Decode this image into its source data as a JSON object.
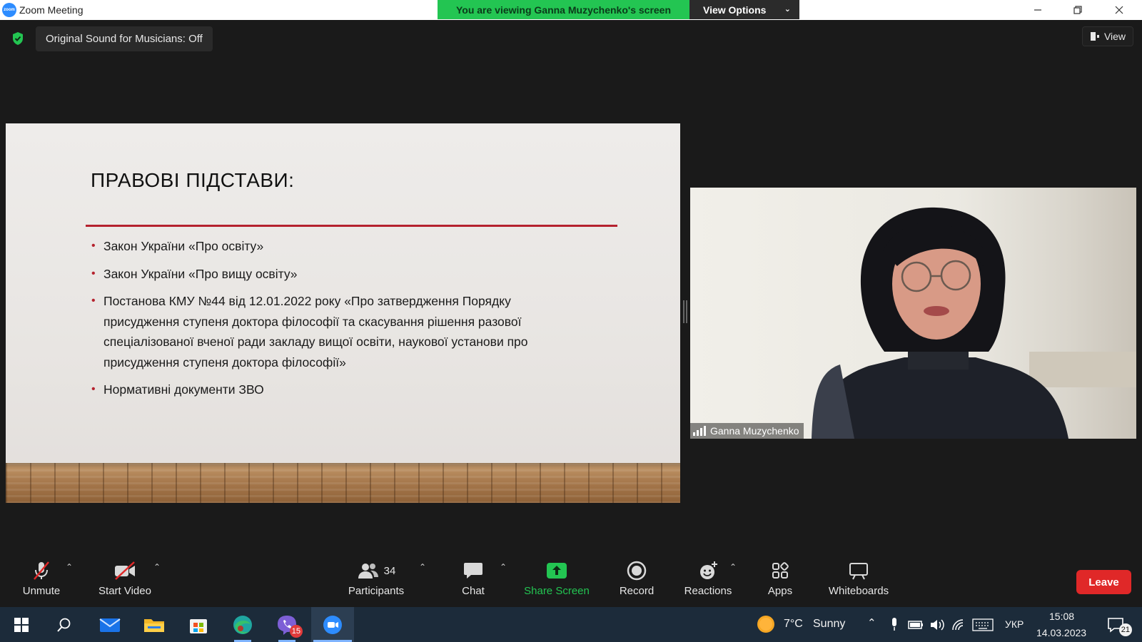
{
  "window": {
    "title": "Zoom Meeting",
    "logo_text": "zoom",
    "viewing_banner": "You are viewing Ganna Muzychenko's screen",
    "view_options_label": "View Options"
  },
  "meeting": {
    "sound_chip": "Original Sound for Musicians: Off",
    "view_label": "View"
  },
  "slide": {
    "title": "ПРАВОВІ ПІДСТАВИ:",
    "bullets": [
      "Закон України «Про освіту»",
      "Закон України «Про вищу освіту»",
      "Постанова КМУ №44 від 12.01.2022 року «Про затвердження Порядку присудження ступеня доктора філософії та скасування рішення разової спеціалізованої вченої ради закладу вищої освіти, наукової установи про присудження ступеня доктора філософії»",
      "Нормативні документи ЗВО"
    ],
    "accent_color": "#b5222e"
  },
  "video": {
    "participant_name": "Ganna Muzychenko"
  },
  "toolbar": {
    "unmute": "Unmute",
    "start_video": "Start Video",
    "participants": "Participants",
    "participants_count": "34",
    "chat": "Chat",
    "share_screen": "Share Screen",
    "record": "Record",
    "reactions": "Reactions",
    "apps": "Apps",
    "whiteboards": "Whiteboards",
    "leave": "Leave",
    "share_color": "#23c552",
    "leave_color": "#e02828"
  },
  "taskbar": {
    "viber_badge": "15",
    "weather_temp": "7°C",
    "weather_text": "Sunny",
    "language": "УКР",
    "time": "15:08",
    "date": "14.03.2023",
    "notifications": "21"
  }
}
